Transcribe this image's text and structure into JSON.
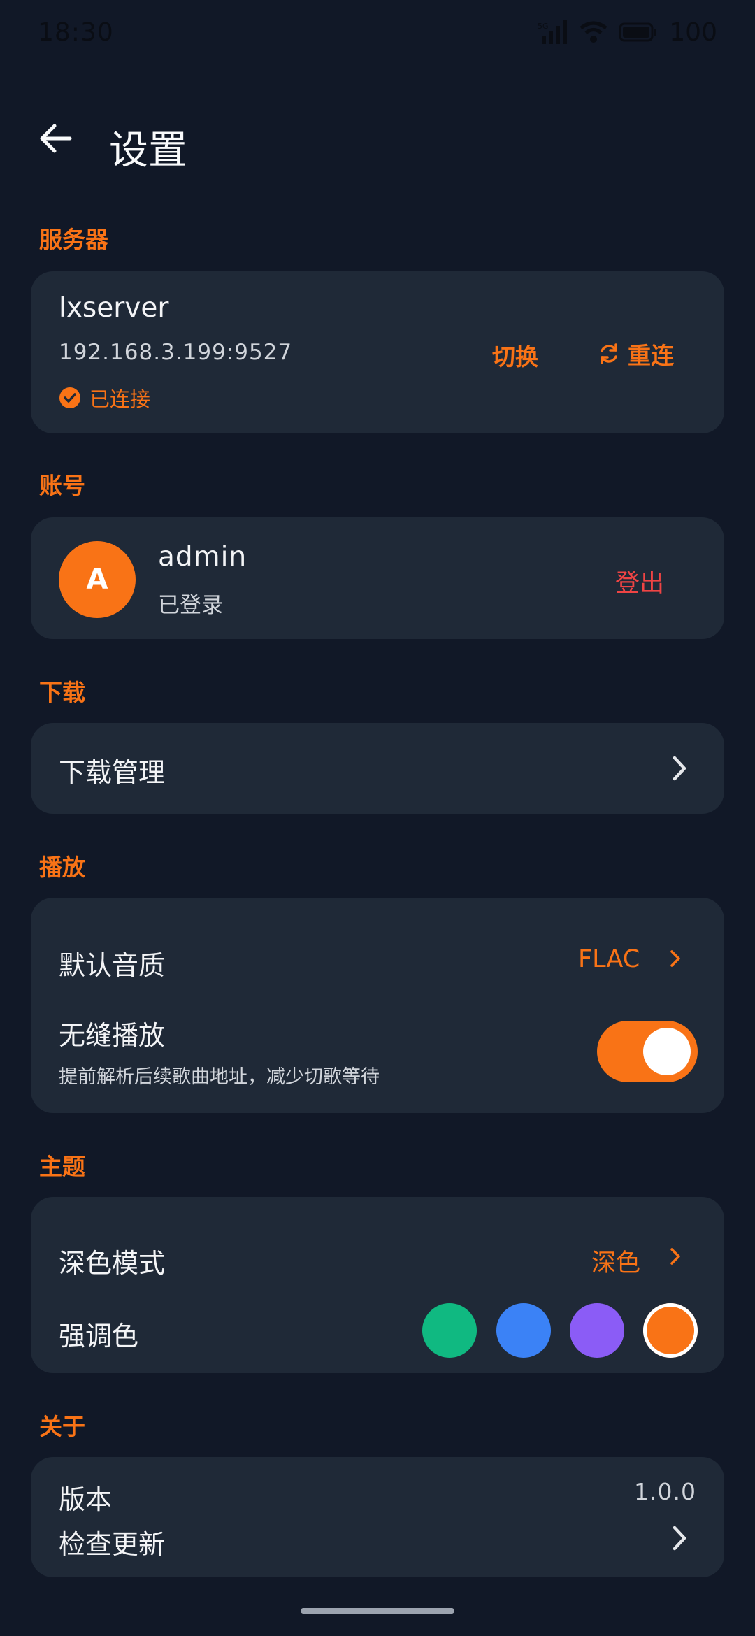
{
  "status_bar": {
    "time": "18:30",
    "battery": "100",
    "network": "5G"
  },
  "header": {
    "title": "设置"
  },
  "server": {
    "section": "服务器",
    "name": "lxserver",
    "address": "192.168.3.199:9527",
    "status": "已连接",
    "switch_label": "切换",
    "reconnect_label": "重连"
  },
  "account": {
    "section": "账号",
    "avatar_letter": "A",
    "username": "admin",
    "status": "已登录",
    "logout_label": "登出"
  },
  "download": {
    "section": "下载",
    "manage_label": "下载管理"
  },
  "playback": {
    "section": "播放",
    "quality_label": "默认音质",
    "quality_value": "FLAC",
    "gapless_label": "无缝播放",
    "gapless_desc": "提前解析后续歌曲地址，减少切歌等待",
    "gapless_enabled": true
  },
  "theme": {
    "section": "主题",
    "dark_mode_label": "深色模式",
    "dark_mode_value": "深色",
    "accent_label": "强调色",
    "accent_colors": [
      "#10B981",
      "#3B82F6",
      "#8B5CF6",
      "#F97316"
    ],
    "selected_accent": "#F97316"
  },
  "about": {
    "section": "关于",
    "version_label": "版本",
    "version_value": "1.0.0",
    "check_update_label": "检查更新"
  },
  "colors": {
    "background": "#111827",
    "card": "#1F2937",
    "accent": "#F97316",
    "danger": "#EF4444"
  }
}
